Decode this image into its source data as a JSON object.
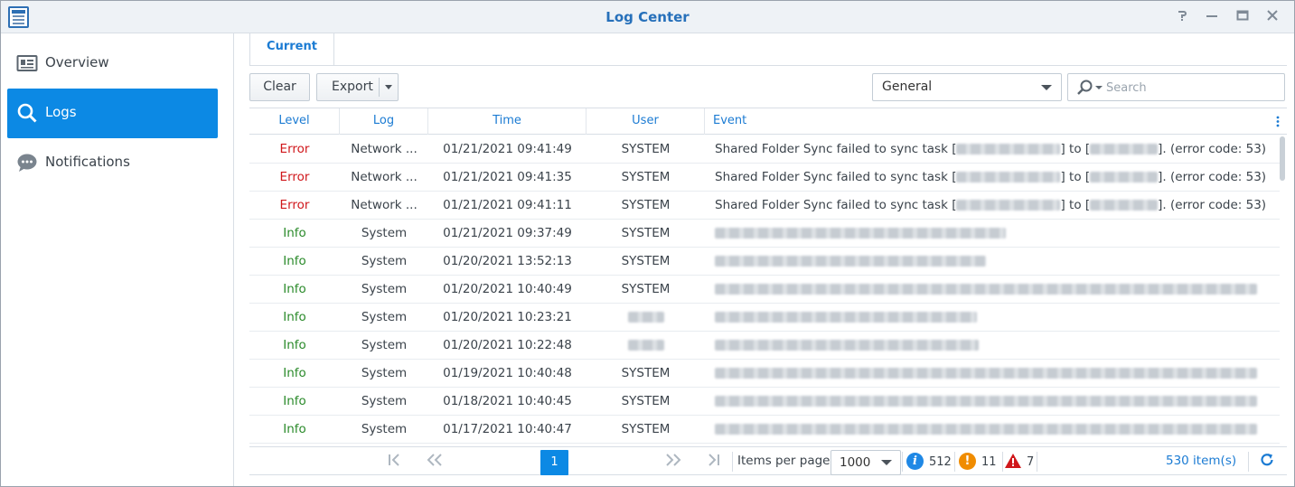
{
  "window": {
    "title": "Log Center"
  },
  "sidebar": {
    "items": [
      {
        "label": "Overview",
        "icon": "overview-icon",
        "active": false
      },
      {
        "label": "Logs",
        "icon": "search-icon",
        "active": true
      },
      {
        "label": "Notifications",
        "icon": "speech-bubble-icon",
        "active": false
      }
    ]
  },
  "tabs": [
    {
      "label": "Current",
      "active": true
    }
  ],
  "toolbar": {
    "clear_label": "Clear",
    "export_label": "Export",
    "filter_value": "General",
    "search_placeholder": "Search"
  },
  "table": {
    "columns": [
      "Level",
      "Log",
      "Time",
      "User",
      "Event"
    ],
    "rows": [
      {
        "level": "Error",
        "log": "Network ...",
        "time": "01/21/2021 09:41:49",
        "user": "SYSTEM",
        "event_prefix": "Shared Folder Sync failed to sync task [",
        "event_mid": "] to [",
        "event_suffix": "]. (error code: 53)"
      },
      {
        "level": "Error",
        "log": "Network ...",
        "time": "01/21/2021 09:41:35",
        "user": "SYSTEM",
        "event_prefix": "Shared Folder Sync failed to sync task [",
        "event_mid": "] to [",
        "event_suffix": "]. (error code: 53)"
      },
      {
        "level": "Error",
        "log": "Network ...",
        "time": "01/21/2021 09:41:11",
        "user": "SYSTEM",
        "event_prefix": "Shared Folder Sync failed to sync task [",
        "event_mid": "] to [",
        "event_suffix": "]. (error code: 53)"
      },
      {
        "level": "Info",
        "log": "System",
        "time": "01/21/2021 09:37:49",
        "user": "SYSTEM"
      },
      {
        "level": "Info",
        "log": "System",
        "time": "01/20/2021 13:52:13",
        "user": "SYSTEM"
      },
      {
        "level": "Info",
        "log": "System",
        "time": "01/20/2021 10:40:49",
        "user": "SYSTEM"
      },
      {
        "level": "Info",
        "log": "System",
        "time": "01/20/2021 10:23:21",
        "user": ""
      },
      {
        "level": "Info",
        "log": "System",
        "time": "01/20/2021 10:22:48",
        "user": ""
      },
      {
        "level": "Info",
        "log": "System",
        "time": "01/19/2021 10:40:48",
        "user": "SYSTEM"
      },
      {
        "level": "Info",
        "log": "System",
        "time": "01/18/2021 10:40:45",
        "user": "SYSTEM"
      },
      {
        "level": "Info",
        "log": "System",
        "time": "01/17/2021 10:40:47",
        "user": "SYSTEM"
      }
    ]
  },
  "pagination": {
    "current_page": "1",
    "items_per_page_label": "Items per page",
    "items_per_page_value": "1000",
    "info_count": "512",
    "warning_count": "11",
    "error_count": "7",
    "total_label": "530 item(s)"
  },
  "colors": {
    "accent": "#0c89e4",
    "error": "#d0171b",
    "info": "#2a8a2a",
    "warning": "#f08c00",
    "header_text": "#1b7bd3"
  }
}
